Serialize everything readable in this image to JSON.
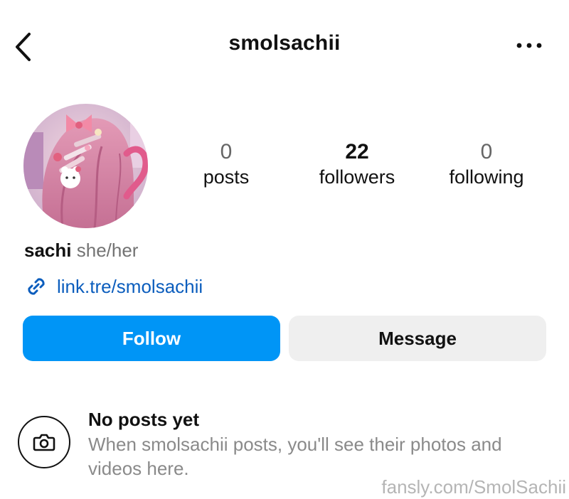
{
  "header": {
    "username": "smolsachii",
    "back_icon": "chevron-left-icon",
    "more_icon": "more-horizontal-icon"
  },
  "profile": {
    "avatar_icon": "profile-avatar",
    "stats": {
      "posts": {
        "count": "0",
        "label": "posts"
      },
      "followers": {
        "count": "22",
        "label": "followers"
      },
      "following": {
        "count": "0",
        "label": "following"
      }
    },
    "bio": {
      "name": "sachi",
      "pronouns": "she/her",
      "link": "link.tre/smolsachii",
      "link_icon": "link-icon"
    }
  },
  "actions": {
    "follow_label": "Follow",
    "message_label": "Message"
  },
  "empty_state": {
    "icon": "camera-icon",
    "title": "No posts yet",
    "description": "When smolsachii posts, you'll see their photos and videos here."
  },
  "watermark": "fansly.com/SmolSachii",
  "colors": {
    "follow_button": "#0095f6",
    "message_button": "#efefef",
    "link": "#0b5dbd",
    "secondary_text": "#8a8a8a"
  }
}
